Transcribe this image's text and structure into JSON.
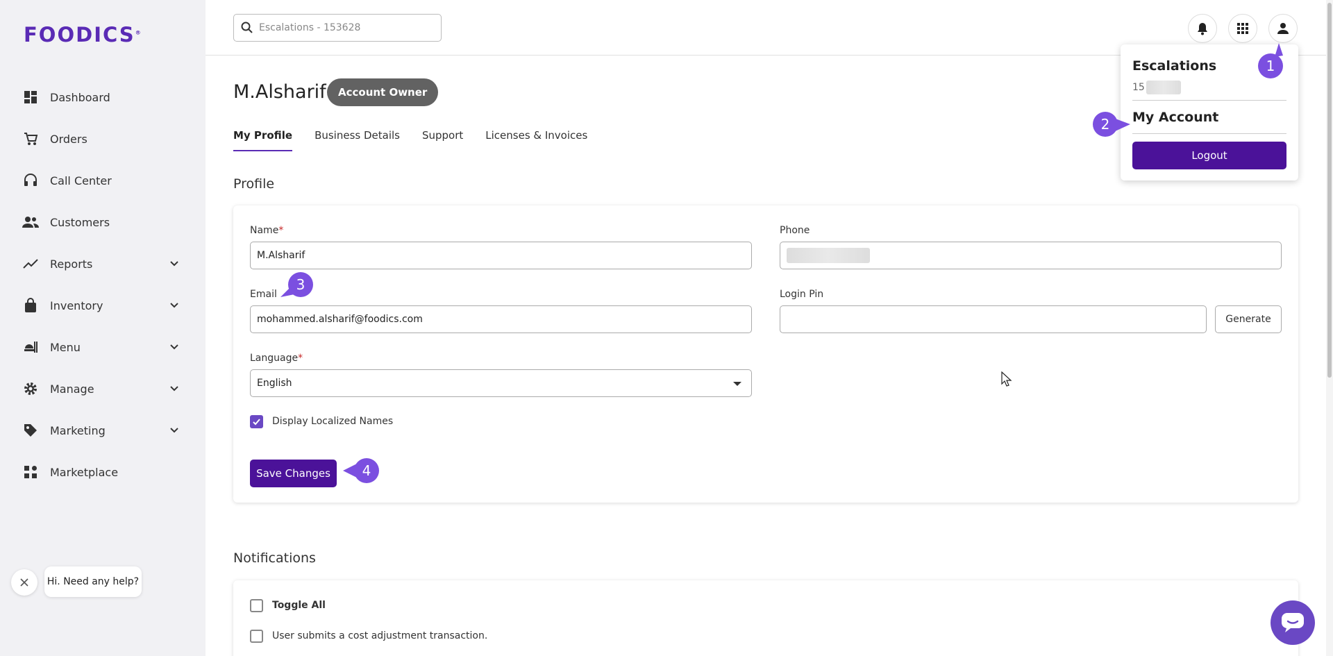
{
  "brand": {
    "logo_text": "FOODICS",
    "logo_mark": "®",
    "accent": "#5a2bb5",
    "button_color": "#4b1299"
  },
  "sidebar": {
    "items": [
      {
        "label": "Dashboard",
        "icon": "dashboard-icon",
        "has_submenu": false
      },
      {
        "label": "Orders",
        "icon": "cart-icon",
        "has_submenu": false
      },
      {
        "label": "Call Center",
        "icon": "headset-icon",
        "has_submenu": false
      },
      {
        "label": "Customers",
        "icon": "people-icon",
        "has_submenu": false
      },
      {
        "label": "Reports",
        "icon": "trend-icon",
        "has_submenu": true
      },
      {
        "label": "Inventory",
        "icon": "bag-icon",
        "has_submenu": true
      },
      {
        "label": "Menu",
        "icon": "food-icon",
        "has_submenu": true
      },
      {
        "label": "Manage",
        "icon": "gear-icon",
        "has_submenu": true
      },
      {
        "label": "Marketing",
        "icon": "tag-icon",
        "has_submenu": true
      },
      {
        "label": "Marketplace",
        "icon": "apps-icon",
        "has_submenu": false
      }
    ]
  },
  "help": {
    "text": "Hi. Need any help?"
  },
  "topbar": {
    "search_placeholder": "Escalations - 153628"
  },
  "page": {
    "title": "M.Alsharif",
    "badge": "Account Owner",
    "tabs": [
      {
        "label": "My Profile",
        "active": true
      },
      {
        "label": "Business Details",
        "active": false
      },
      {
        "label": "Support",
        "active": false
      },
      {
        "label": "Licenses & Invoices",
        "active": false
      }
    ],
    "profile_section": "Profile",
    "notifications_section": "Notifications"
  },
  "form": {
    "name_label": "Name",
    "name_value": "M.Alsharif",
    "phone_label": "Phone",
    "email_label": "Email",
    "email_value": "mohammed.alsharif@foodics.com",
    "login_pin_label": "Login Pin",
    "generate_label": "Generate",
    "language_label": "Language",
    "language_value": "English",
    "localized_label": "Display Localized Names",
    "localized_checked": true,
    "save_label": "Save Changes",
    "required_mark": "*"
  },
  "notifications": {
    "toggle_all": "Toggle All",
    "items": [
      "User submits a cost adjustment transaction."
    ]
  },
  "account_menu": {
    "business_name": "Escalations",
    "business_ref_prefix": "15",
    "my_account": "My Account",
    "logout": "Logout"
  },
  "callouts": [
    "1",
    "2",
    "3",
    "4"
  ]
}
